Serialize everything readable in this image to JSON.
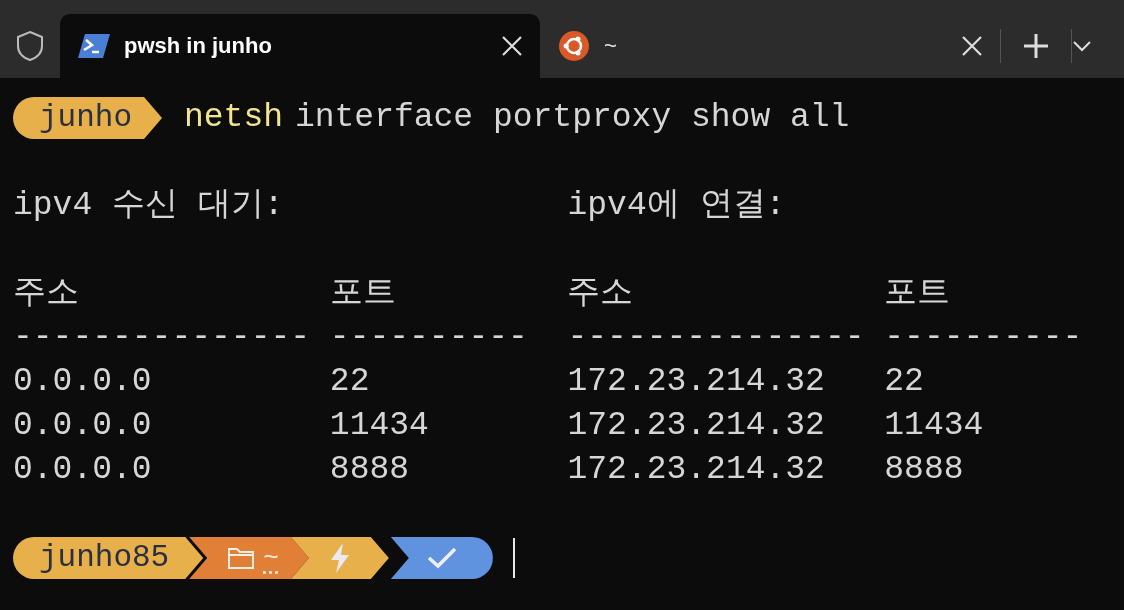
{
  "tabs": [
    {
      "title": "pwsh in junho",
      "selected": true,
      "kind": "powershell"
    },
    {
      "title": "~",
      "selected": false,
      "kind": "ubuntu"
    }
  ],
  "prompt": {
    "user": "junho",
    "command": "netsh",
    "args": "interface portproxy show all"
  },
  "output": {
    "sections": [
      "ipv4 수신 대기:",
      "ipv4에 연결:"
    ],
    "headers": [
      "주소",
      "포트",
      "주소",
      "포트"
    ],
    "separators": [
      "---------------",
      "----------",
      "---------------",
      "----------"
    ],
    "rows": [
      [
        "0.0.0.0",
        "22",
        "172.23.214.32",
        "22"
      ],
      [
        "0.0.0.0",
        "11434",
        "172.23.214.32",
        "11434"
      ],
      [
        "0.0.0.0",
        "8888",
        "172.23.214.32",
        "8888"
      ]
    ]
  },
  "status_prompt": {
    "user": "junho85",
    "path": "~"
  }
}
